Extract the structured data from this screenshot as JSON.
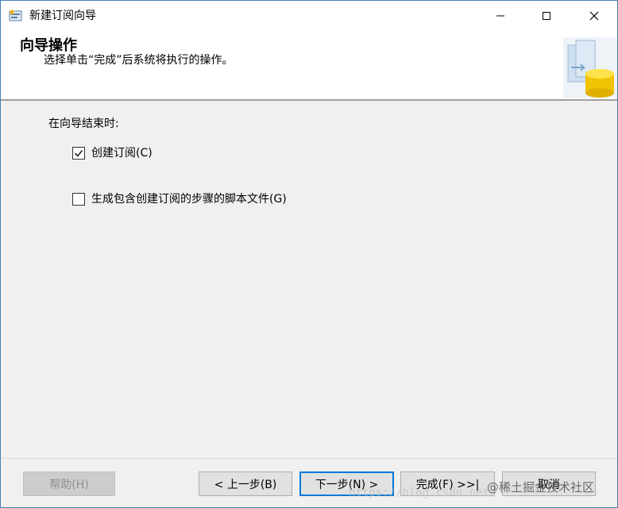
{
  "window": {
    "title": "新建订阅向导",
    "icon": "wizard-icon"
  },
  "header": {
    "title": "向导操作",
    "subtitle": "选择单击“完成”后系统将执行的操作。"
  },
  "content": {
    "section_label": "在向导结束时:",
    "options": [
      {
        "label": "创建订阅(C)",
        "checked": true
      },
      {
        "label": "生成包含创建订阅的步骤的脚本文件(G)",
        "checked": false
      }
    ]
  },
  "footer": {
    "help": "帮助(H)",
    "back": "< 上一步(B)",
    "next": "下一步(N) >",
    "finish": "完成(F) >>|",
    "cancel": "取消"
  },
  "watermark": {
    "text": "@稀土掘金技术社区",
    "url": "https://blog.csdn.net/"
  },
  "colors": {
    "accent": "#0078d7",
    "window_border": "#4a7fb5"
  }
}
